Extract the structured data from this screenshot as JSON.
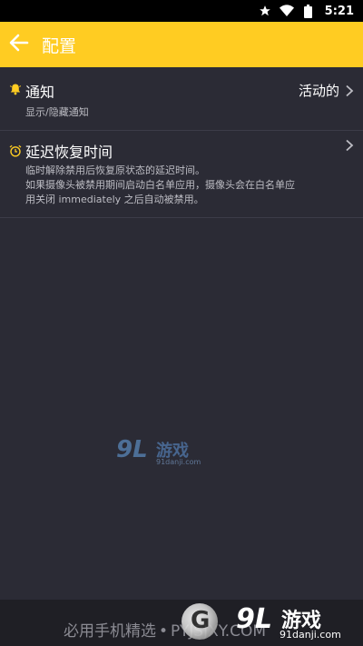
{
  "status_bar": {
    "time": "5:21",
    "icons": [
      "star-icon",
      "wifi-icon",
      "battery-icon"
    ]
  },
  "app_bar": {
    "title": "配置",
    "back_icon": "arrow-left-icon",
    "background": "#ffcc22"
  },
  "settings": {
    "notification": {
      "icon": "bell-icon",
      "title": "通知",
      "subtitle": "显示/隐藏通知",
      "value": "活动的"
    },
    "delay": {
      "icon": "alarm-clock-icon",
      "title": "延迟恢复时间",
      "description_lines": [
        "临时解除禁用后恢复原状态的延迟时间。",
        "如果摄像头被禁用期间启动白名单应用，摄像头会在白名单应",
        "用关闭 immediately 之后自动被禁用。"
      ]
    }
  },
  "watermark": {
    "logo": "9L",
    "name": "游戏",
    "url": "91danji.com"
  },
  "footer": {
    "text": "必用手机精选",
    "dot": "•",
    "site": "PYJSJXY.COM",
    "logo": "9L",
    "logo_name": "游戏",
    "logo_url": "91danji.com",
    "circle_letter": "G"
  }
}
